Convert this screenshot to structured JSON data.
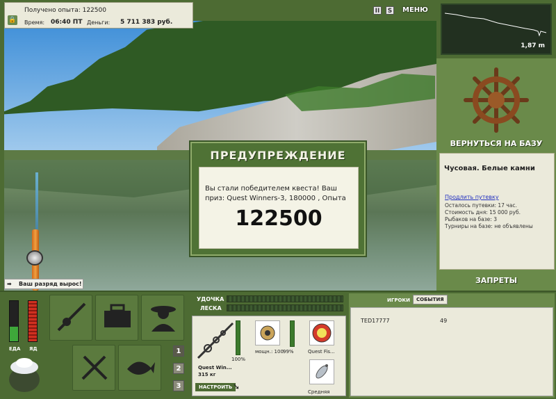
{
  "status": {
    "experience_text": "Получено опыта: 122500",
    "time_label": "Время:",
    "time_value": "06:40 ПТ",
    "money_label": "Деньги:",
    "money_value": "5 711 383 руб."
  },
  "topbar": {
    "pause": "II",
    "sound": "S",
    "menu": "МЕНЮ"
  },
  "depth": {
    "value": "1,87 m"
  },
  "location": {
    "back_to_base": "ВЕРНУТЬСЯ НА БАЗУ",
    "place": "Чусовая. Белые камни",
    "extend_link": "Продлить путевку",
    "lines": [
      "Осталось путевки: 17 час.",
      "Стоимость дня: 15 000 руб.",
      "Рыбаков на базе: 3",
      "Турниры на базе: не объявлены"
    ],
    "bans": "ЗАПРЕТЫ"
  },
  "dialog": {
    "title": "ПРЕДУПРЕЖДЕНИЕ",
    "message": "Вы стали победителем квеста! Ваш приз: Quest Winners-3, 180000 , Опыта",
    "amount": "122500"
  },
  "rank_banner": "Ваш разряд вырос!",
  "meters": {
    "food": "ЕДА",
    "poison": "ЯД"
  },
  "pages": [
    "1",
    "2",
    "3"
  ],
  "tackle": {
    "rod_label": "УДОЧКА",
    "line_label": "ЛЕСКА",
    "rod_name": "Quest Win...",
    "rod_weight": "315 кг",
    "rod_percent": "100%",
    "setup_button": "НАСТРОИТЬ",
    "reel_power": "мощн.: 100",
    "reel_percent": "99%",
    "line_name": "Quest Fis...",
    "lure_name": "Средняя"
  },
  "players": {
    "tabs": [
      "ИГРОКИ",
      "СОБЫТИЯ"
    ],
    "rows": [
      {
        "name": "TED17777",
        "value": "49"
      }
    ]
  }
}
